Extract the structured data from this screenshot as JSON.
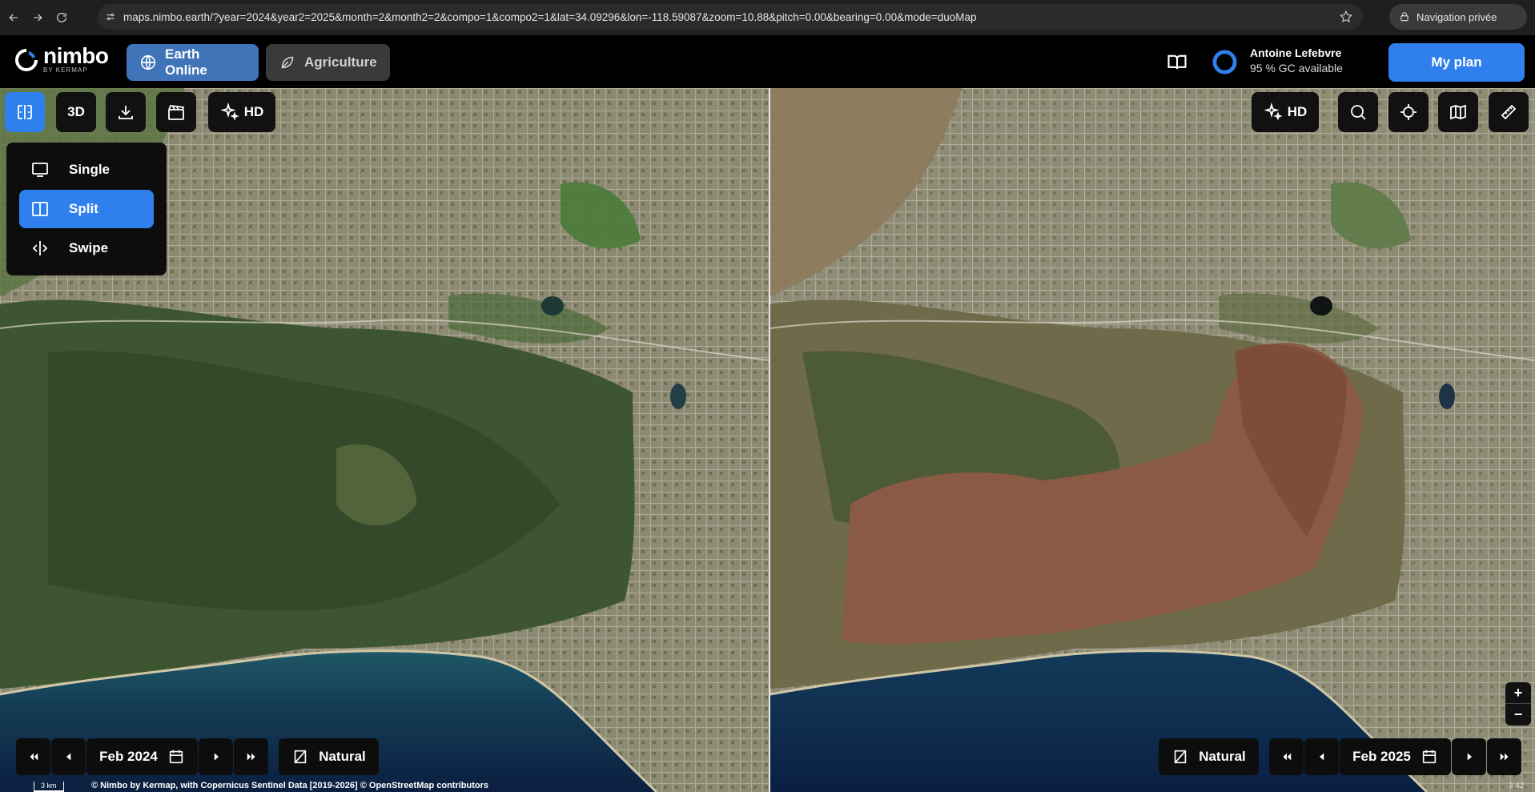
{
  "browser": {
    "url": "maps.nimbo.earth/?year=2024&year2=2025&month=2&month2=2&compo=1&compo2=1&lat=34.09296&lon=-118.59087&zoom=10.88&pitch=0.00&bearing=0.00&mode=duoMap",
    "private_label": "Navigation privée"
  },
  "header": {
    "logo_name": "nimbo",
    "logo_sub": "BY KERMAP",
    "tabs": [
      {
        "label": "Earth Online",
        "active": true,
        "icon": "globe-icon"
      },
      {
        "label": "Agriculture",
        "active": false,
        "icon": "leaf-icon"
      }
    ],
    "user": {
      "name": "Antoine Lefebvre",
      "credits": "95 % GC available"
    },
    "plan_button": "My plan"
  },
  "toolbar_left": {
    "view3d": "3D",
    "hd": "HD"
  },
  "toolbar_right": {
    "hd": "HD"
  },
  "mode_menu": {
    "items": [
      {
        "label": "Single",
        "selected": false,
        "icon": "monitor-icon"
      },
      {
        "label": "Split",
        "selected": true,
        "icon": "split-icon"
      },
      {
        "label": "Swipe",
        "selected": false,
        "icon": "swipe-icon"
      }
    ]
  },
  "left_map": {
    "date": "Feb 2024",
    "layer": "Natural"
  },
  "right_map": {
    "date": "Feb 2025",
    "layer": "Natural"
  },
  "zoom": {
    "in": "+",
    "out": "−"
  },
  "footer": {
    "scale": "3 km",
    "attribution": "© Nimbo by Kermap, with Copernicus Sentinel Data [2019-2026] © OpenStreetMap contributors",
    "zoom_level": "3.42"
  },
  "colors": {
    "accent": "#2f80ed",
    "tab_active": "#3f74b8",
    "burn_scar": "#8a5a44",
    "vegetation": "#3d5a2e",
    "ocean": "#0f2e45"
  }
}
